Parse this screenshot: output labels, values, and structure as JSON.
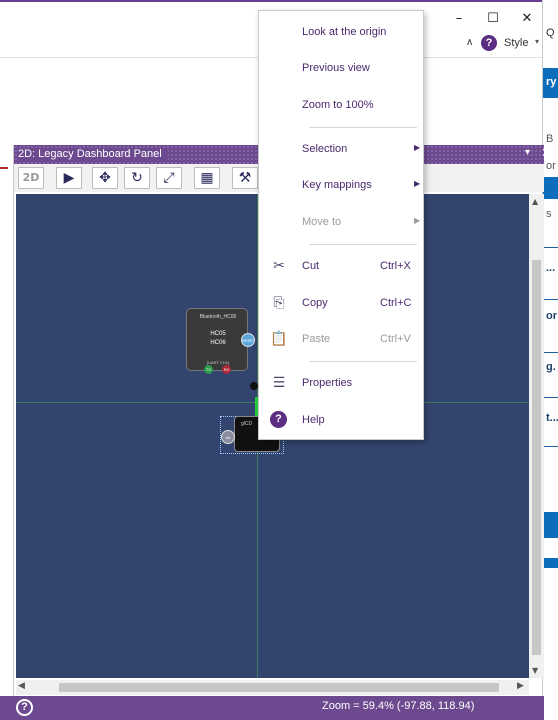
{
  "window": {
    "minimize_glyph": "–",
    "maximize_glyph": "☐",
    "close_glyph": "✕",
    "collapse_glyph": "∧",
    "help_glyph": "?",
    "style_label": "Style",
    "style_drop_glyph": "▾"
  },
  "right_panel": {
    "fragments": [
      "Q",
      "ry",
      "B",
      "or",
      "s",
      "...",
      "or",
      "g.",
      "t..."
    ]
  },
  "panel": {
    "title": "2D: Legacy Dashboard Panel",
    "title_drop_glyph": "▾",
    "title_close_glyph": "✕",
    "toolbar": {
      "btn_2d": "2D",
      "pointer_glyph": "▶",
      "pan_glyph": "✥",
      "rotate_glyph": "↻",
      "zoom_extent_glyph": "⤢",
      "grid_glyph": "▦",
      "wrench_glyph": "⚒"
    }
  },
  "canvas": {
    "bt_module": {
      "title": "Bluetooth_HC05",
      "line1": "HC05",
      "line2": "HC06",
      "uart": "[UART CH1]",
      "pin_tx": "TX",
      "pin_rx": "RX",
      "pin_reset": "RESET"
    },
    "lcd_module": {
      "label": "glCD",
      "pin": "sA"
    }
  },
  "scroll": {
    "up_glyph": "▲",
    "down_glyph": "▼",
    "left_glyph": "◀",
    "right_glyph": "▶"
  },
  "status": {
    "help_glyph": "?",
    "zoom_text": "Zoom = 59.4% (-97.88, 118.94)"
  },
  "context_menu": {
    "look_at_origin": "Look at the origin",
    "previous_view": "Previous view",
    "zoom_100": "Zoom to 100%",
    "selection": "Selection",
    "key_mappings": "Key mappings",
    "move_to": "Move to",
    "cut": "Cut",
    "cut_shortcut": "Ctrl+X",
    "copy": "Copy",
    "copy_shortcut": "Ctrl+C",
    "paste": "Paste",
    "paste_shortcut": "Ctrl+V",
    "properties": "Properties",
    "help": "Help",
    "submenu_arrow": "▶",
    "cut_icon_glyph": "✂",
    "copy_icon_glyph": "⎘",
    "paste_icon_glyph": "📋",
    "properties_icon_glyph": "☰",
    "help_icon_glyph": "?"
  },
  "colors": {
    "accent_purple": "#6d4a90",
    "menu_text": "#4a2a6e",
    "canvas_bg": "#33456e",
    "axis_green": "#3f7a5a"
  }
}
